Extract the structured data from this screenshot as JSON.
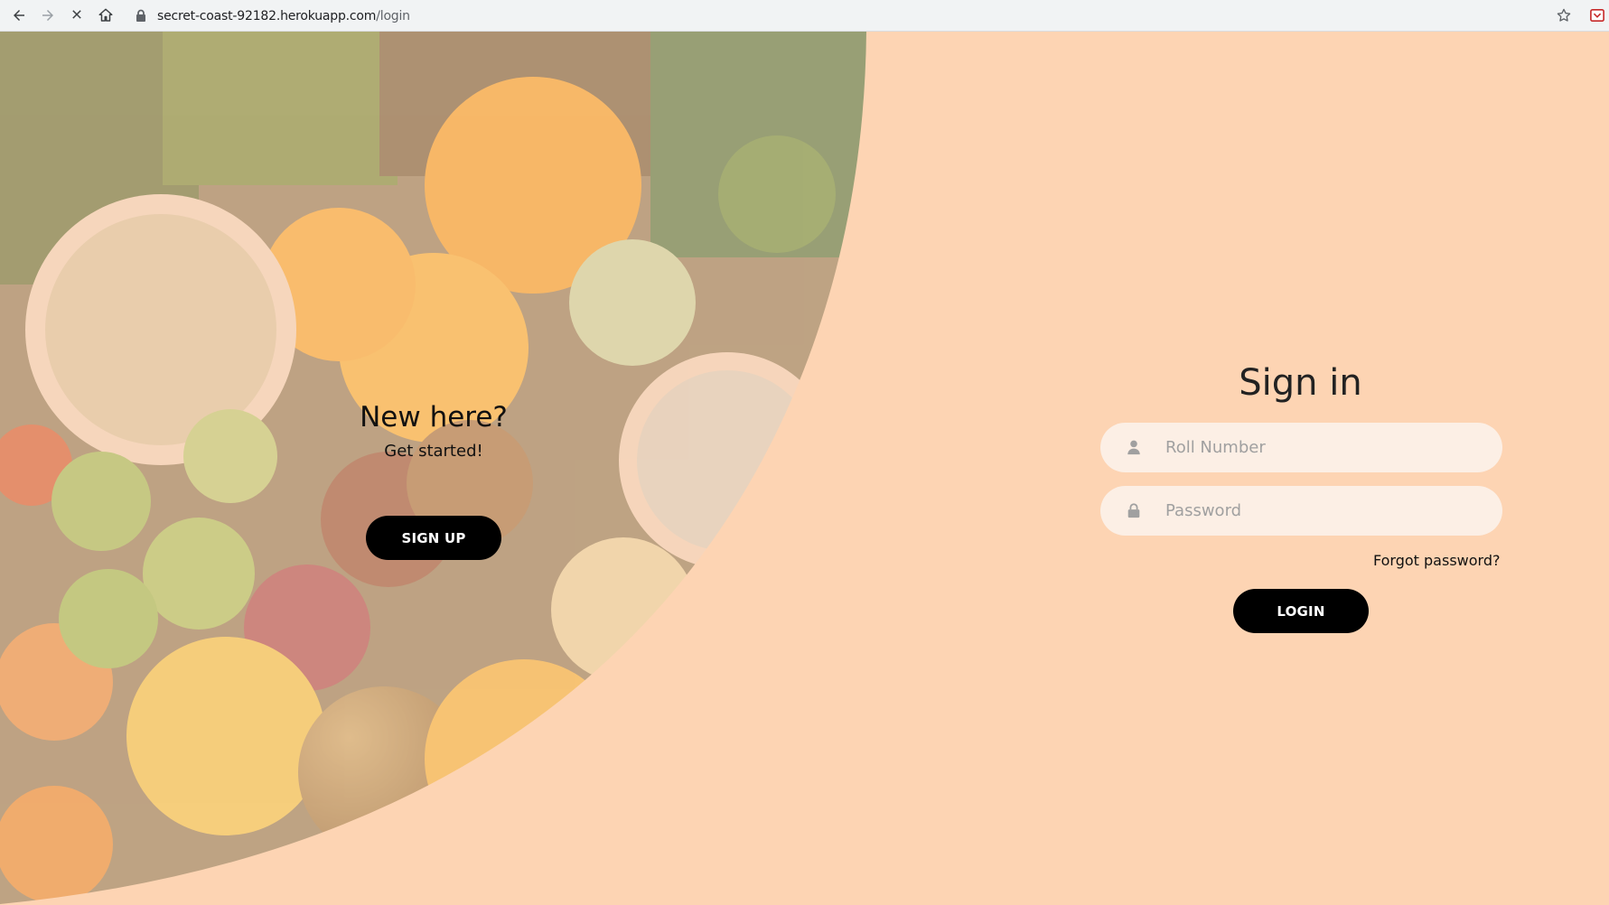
{
  "browser": {
    "url_host": "secret-coast-92182.herokuapp.com",
    "url_path": "/login"
  },
  "left_panel": {
    "title": "New here?",
    "subtitle": "Get started!",
    "signup_label": "SIGN UP"
  },
  "sign_in": {
    "title": "Sign in",
    "roll_placeholder": "Roll Number",
    "password_placeholder": "Password",
    "forgot_label": "Forgot password?",
    "login_label": "LOGIN"
  },
  "colors": {
    "page_background": "#fdd4b3",
    "field_background": "#fcefe5",
    "button_background": "#000000"
  }
}
